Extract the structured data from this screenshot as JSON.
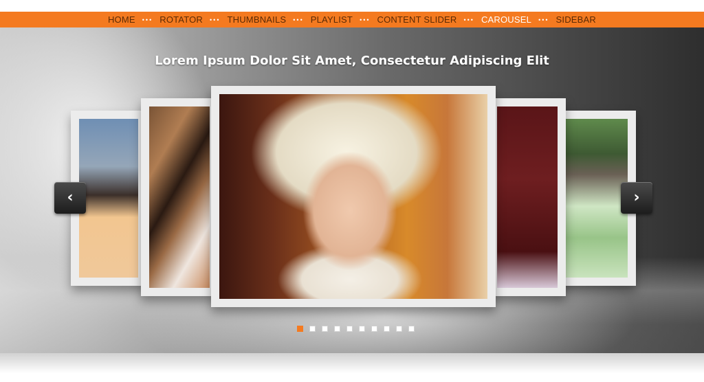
{
  "nav": {
    "items": [
      {
        "label": "HOME",
        "active": false
      },
      {
        "label": "ROTATOR",
        "active": false
      },
      {
        "label": "THUMBNAILS",
        "active": false
      },
      {
        "label": "PLAYLIST",
        "active": false
      },
      {
        "label": "CONTENT SLIDER",
        "active": false
      },
      {
        "label": "CAROUSEL",
        "active": true
      },
      {
        "label": "SIDEBAR",
        "active": false
      }
    ],
    "separator": "•••"
  },
  "carousel": {
    "caption": "Lorem Ipsum Dolor Sit Amet, Consectetur Adipiscing Elit",
    "prev_icon": "chevron-left-icon",
    "next_icon": "chevron-right-icon",
    "prev_glyph": "‹",
    "next_glyph": "›",
    "slide_count": 10,
    "active_slide": 1
  },
  "colors": {
    "accent": "#f47a20",
    "nav_text": "#5a2a05",
    "nav_active_text": "#ffffff"
  }
}
